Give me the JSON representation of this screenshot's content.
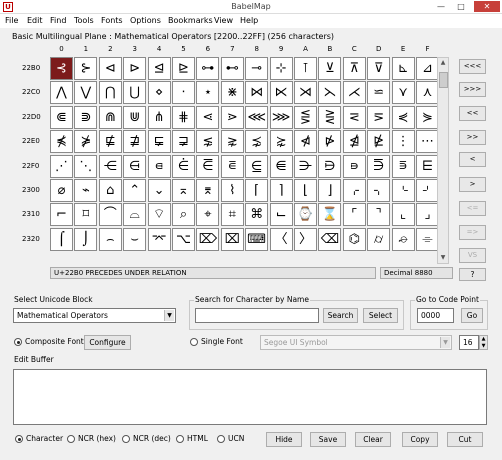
{
  "window": {
    "title": "BabelMap",
    "icon_letter": "U"
  },
  "menu": [
    "File",
    "Edit",
    "Find",
    "Tools",
    "Fonts",
    "Options",
    "Bookmarks",
    "View",
    "Help"
  ],
  "grid": {
    "label": "Basic Multilingual Plane : Mathematical Operators [2200..22FF] (256 characters)",
    "columns": [
      "0",
      "1",
      "2",
      "3",
      "4",
      "5",
      "6",
      "7",
      "8",
      "9",
      "A",
      "B",
      "C",
      "D",
      "E",
      "F"
    ],
    "rows": [
      {
        "code": "22B0",
        "cells": [
          "⊰",
          "⊱",
          "⊲",
          "⊳",
          "⊴",
          "⊵",
          "⊶",
          "⊷",
          "⊸",
          "⊹",
          "⊺",
          "⊻",
          "⊼",
          "⊽",
          "⊾",
          "⊿"
        ]
      },
      {
        "code": "22C0",
        "cells": [
          "⋀",
          "⋁",
          "⋂",
          "⋃",
          "⋄",
          "⋅",
          "⋆",
          "⋇",
          "⋈",
          "⋉",
          "⋊",
          "⋋",
          "⋌",
          "⋍",
          "⋎",
          "⋏"
        ]
      },
      {
        "code": "22D0",
        "cells": [
          "⋐",
          "⋑",
          "⋒",
          "⋓",
          "⋔",
          "⋕",
          "⋖",
          "⋗",
          "⋘",
          "⋙",
          "⋚",
          "⋛",
          "⋜",
          "⋝",
          "⋞",
          "⋟"
        ]
      },
      {
        "code": "22E0",
        "cells": [
          "⋠",
          "⋡",
          "⋢",
          "⋣",
          "⋤",
          "⋥",
          "⋦",
          "⋧",
          "⋨",
          "⋩",
          "⋪",
          "⋫",
          "⋬",
          "⋭",
          "⋮",
          "⋯"
        ]
      },
      {
        "code": "22F0",
        "cells": [
          "⋰",
          "⋱",
          "⋲",
          "⋳",
          "⋴",
          "⋵",
          "⋶",
          "⋷",
          "⋸",
          "⋹",
          "⋺",
          "⋻",
          "⋼",
          "⋽",
          "⋾",
          "⋿"
        ]
      },
      {
        "code": "2300",
        "cells": [
          "⌀",
          "⌁",
          "⌂",
          "⌃",
          "⌄",
          "⌅",
          "⌆",
          "⌇",
          "⌈",
          "⌉",
          "⌊",
          "⌋",
          "⌌",
          "⌍",
          "⌎",
          "⌏"
        ]
      },
      {
        "code": "2310",
        "cells": [
          "⌐",
          "⌑",
          "⌒",
          "⌓",
          "⌔",
          "⌕",
          "⌖",
          "⌗",
          "⌘",
          "⌙",
          "⌚",
          "⌛",
          "⌜",
          "⌝",
          "⌞",
          "⌟"
        ]
      },
      {
        "code": "2320",
        "cells": [
          "⌠",
          "⌡",
          "⌢",
          "⌣",
          "⌤",
          "⌥",
          "⌦",
          "⌧",
          "⌨",
          "〈",
          "〉",
          "⌫",
          "⌬",
          "⌭",
          "⌮",
          "⌯"
        ]
      }
    ],
    "selected": {
      "row": 0,
      "col": 0
    }
  },
  "nav_buttons": [
    {
      "label": "<<<",
      "enabled": true
    },
    {
      "label": ">>>",
      "enabled": true
    },
    {
      "label": "<<",
      "enabled": true
    },
    {
      "label": ">>",
      "enabled": true
    },
    {
      "label": "<",
      "enabled": true
    },
    {
      "label": ">",
      "enabled": true
    },
    {
      "label": "<=",
      "enabled": false
    },
    {
      "label": "=>",
      "enabled": false
    },
    {
      "label": "VS",
      "enabled": false
    },
    {
      "label": "?",
      "enabled": true
    }
  ],
  "status": {
    "description": "U+22B0 PRECEDES UNDER RELATION",
    "decimal": "Decimal 8880"
  },
  "unicode_block": {
    "label": "Select Unicode Block",
    "value": "Mathematical Operators"
  },
  "search": {
    "label": "Search for Character by Name",
    "value": "",
    "search_button": "Search",
    "select_button": "Select"
  },
  "goto": {
    "label": "Go to Code Point",
    "value": "0000",
    "button": "Go"
  },
  "font": {
    "composite_label": "Composite Font",
    "configure_button": "Configure",
    "single_label": "Single Font",
    "single_value": "Segoe UI Symbol",
    "size": "16"
  },
  "edit_buffer": {
    "label": "Edit Buffer",
    "value": ""
  },
  "format_options": [
    "Character",
    "NCR (hex)",
    "NCR (dec)",
    "HTML",
    "UCN"
  ],
  "format_selected": 0,
  "actions": [
    "Hide",
    "Save",
    "Clear",
    "Copy",
    "Cut"
  ]
}
